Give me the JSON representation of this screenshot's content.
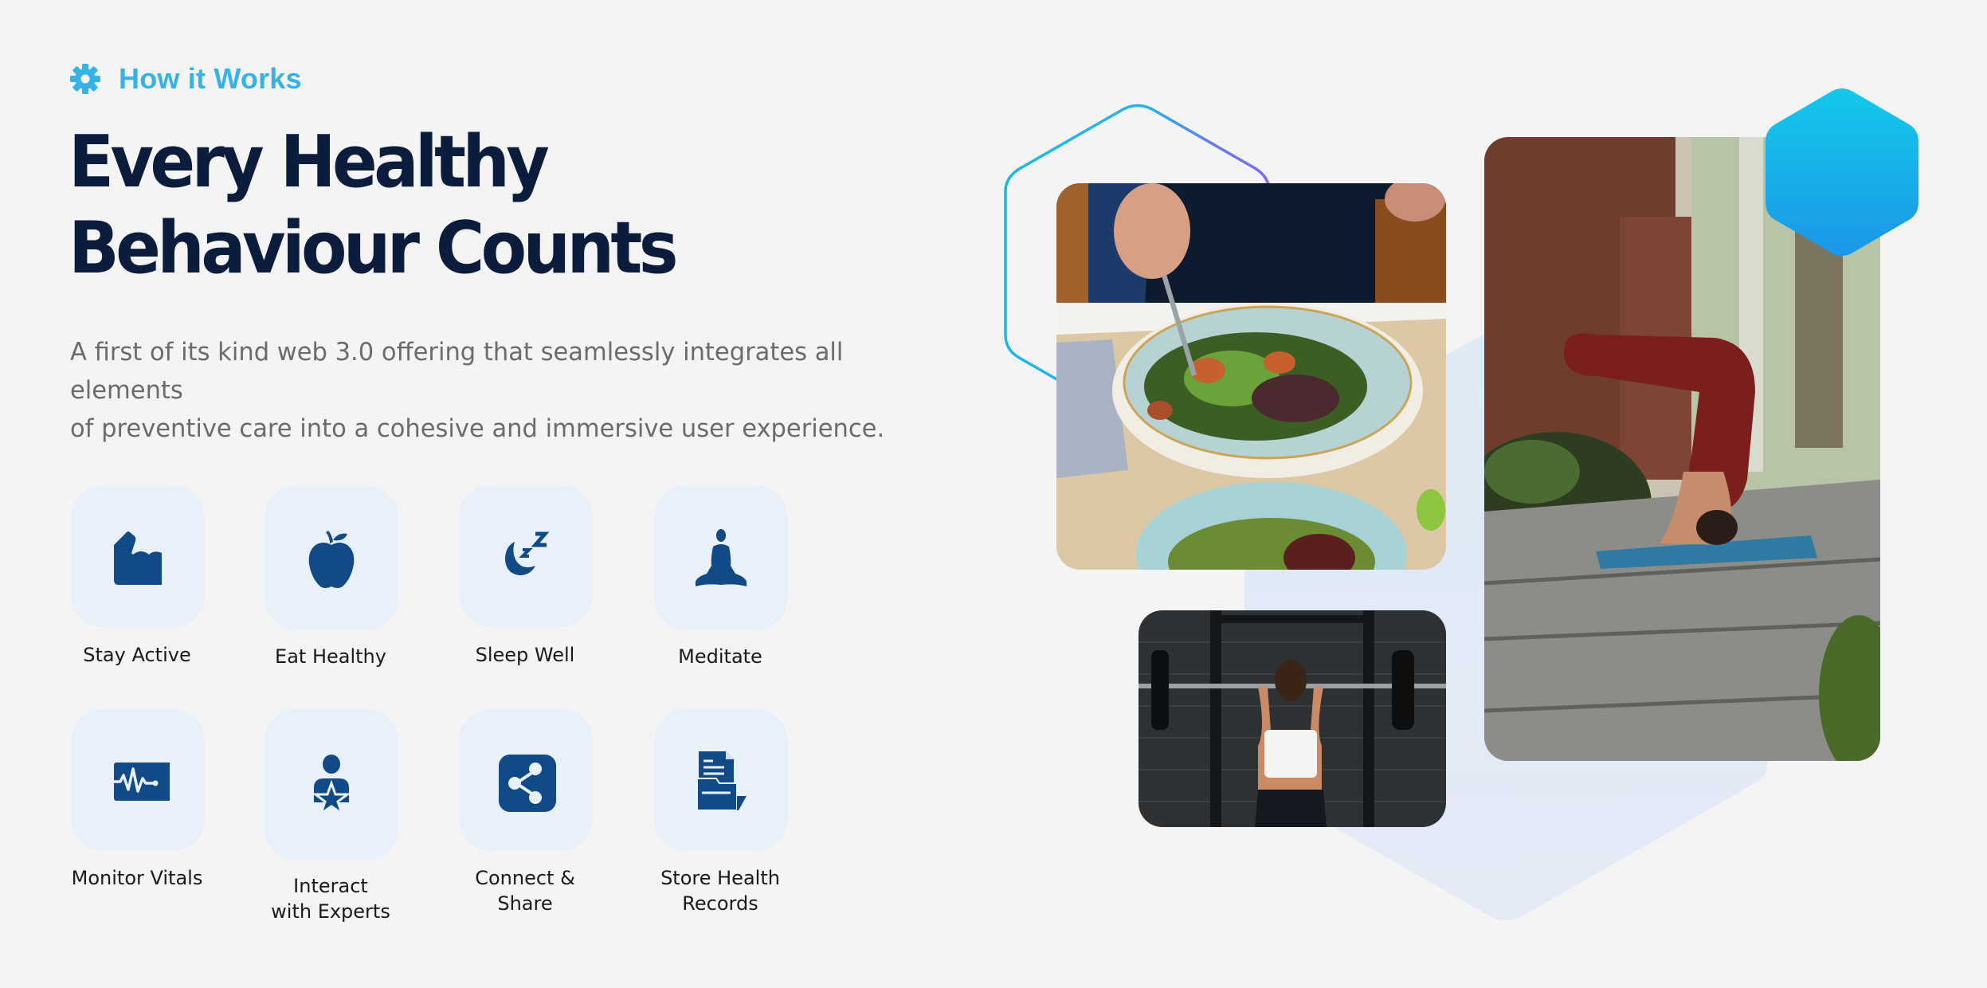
{
  "section": {
    "eyebrow_icon": "gear-icon",
    "eyebrow": "How it Works",
    "title_lines": [
      "Every Healthy",
      "Behaviour Counts"
    ],
    "subtitle_lines": [
      "A first of its kind web 3.0 offering that seamlessly integrates all elements",
      "of preventive care into a cohesive and immersive user experience."
    ]
  },
  "features": [
    {
      "label": "Stay Active",
      "icon": "flexed-bicep-icon"
    },
    {
      "label": "Eat Healthy",
      "icon": "apple-icon"
    },
    {
      "label": "Sleep Well",
      "icon": "moon-sleep-icon"
    },
    {
      "label": "Meditate",
      "icon": "meditation-icon"
    },
    {
      "label": "Monitor Vitals",
      "icon": "heartbeat-monitor-icon"
    },
    {
      "label_lines": [
        "Interact",
        "with Experts"
      ],
      "icon": "expert-star-icon"
    },
    {
      "label_lines": [
        "Connect &",
        "Share"
      ],
      "icon": "share-icon"
    },
    {
      "label_lines": [
        "Store Health",
        "Records"
      ],
      "icon": "health-records-icon"
    }
  ],
  "images": [
    {
      "subject": "salad bowl being eaten"
    },
    {
      "subject": "woman lifting barbell in gym"
    },
    {
      "subject": "woman doing yoga headstand outdoors"
    }
  ],
  "colors": {
    "accent": "#38b2e6",
    "heading": "#0c1c3d",
    "body": "#6b6b6b",
    "icon": "#114a86",
    "tile": "#e8f0fa",
    "background": "#f4f4f4",
    "hex_fill_top": "#14c9ea",
    "hex_fill_bottom": "#1b97e8",
    "hex_outline_start": "#1bb8e6",
    "hex_outline_end": "#7a6ef0"
  }
}
